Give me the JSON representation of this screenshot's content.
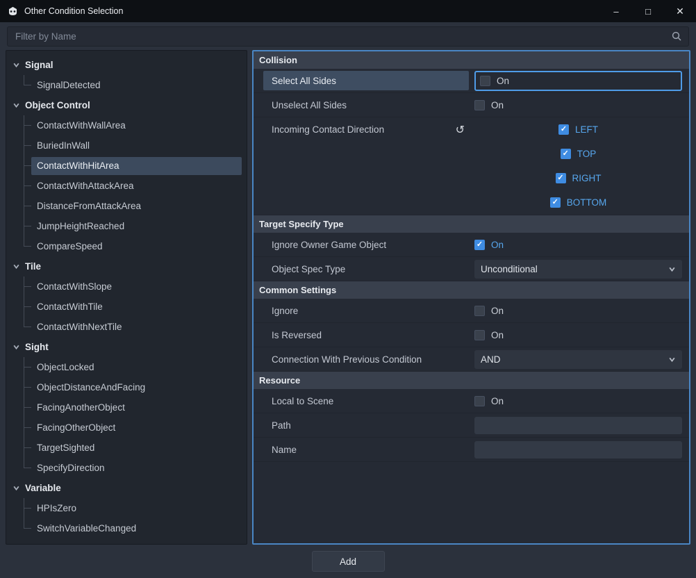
{
  "window": {
    "title": "Other Condition Selection",
    "controls": {
      "minimize": "–",
      "maximize": "□",
      "close": "✕"
    }
  },
  "filter": {
    "placeholder": "Filter by Name"
  },
  "icons": {
    "revert": "↺",
    "check": "✓"
  },
  "colors": {
    "accent_blue": "#57a7ee",
    "checkbox_checked": "#3f8ce2",
    "focus_border": "#4f9ce8",
    "panel_focus_border": "#4a86c4",
    "selection": "#3c4a5d",
    "section_header_bg": "#39404d",
    "titlebar_bg": "#0d1014"
  },
  "tree": {
    "groups": [
      {
        "label": "Signal",
        "items": [
          "SignalDetected"
        ]
      },
      {
        "label": "Object Control",
        "items": [
          "ContactWithWallArea",
          "BuriedInWall",
          "ContactWithHitArea",
          "ContactWithAttackArea",
          "DistanceFromAttackArea",
          "JumpHeightReached",
          "CompareSpeed"
        ],
        "selected_item": "ContactWithHitArea"
      },
      {
        "label": "Tile",
        "items": [
          "ContactWithSlope",
          "ContactWithTile",
          "ContactWithNextTile"
        ]
      },
      {
        "label": "Sight",
        "items": [
          "ObjectLocked",
          "ObjectDistanceAndFacing",
          "FacingAnotherObject",
          "FacingOtherObject",
          "TargetSighted",
          "SpecifyDirection"
        ]
      },
      {
        "label": "Variable",
        "items": [
          "HPIsZero",
          "SwitchVariableChanged"
        ]
      }
    ]
  },
  "inspector": {
    "sections": [
      {
        "title": "Collision",
        "rows": [
          {
            "label": "Select All Sides",
            "type": "checkbox",
            "checked": false,
            "value": "On",
            "selected": true,
            "focused": true
          },
          {
            "label": "Unselect All Sides",
            "type": "checkbox",
            "checked": false,
            "value": "On"
          },
          {
            "label": "Incoming Contact Direction",
            "type": "flags",
            "revert": true,
            "flags": [
              {
                "label": "LEFT",
                "checked": true
              },
              {
                "label": "TOP",
                "checked": true
              },
              {
                "label": "RIGHT",
                "checked": true
              },
              {
                "label": "BOTTOM",
                "checked": true
              }
            ]
          }
        ]
      },
      {
        "title": "Target Specify Type",
        "rows": [
          {
            "label": "Ignore Owner Game Object",
            "type": "checkbox",
            "checked": true,
            "value": "On"
          },
          {
            "label": "Object Spec Type",
            "type": "dropdown",
            "value": "Unconditional"
          }
        ]
      },
      {
        "title": "Common Settings",
        "rows": [
          {
            "label": "Ignore",
            "type": "checkbox",
            "checked": false,
            "value": "On"
          },
          {
            "label": "Is Reversed",
            "type": "checkbox",
            "checked": false,
            "value": "On"
          },
          {
            "label": "Connection With Previous Condition",
            "type": "dropdown",
            "value": "AND"
          }
        ]
      },
      {
        "title": "Resource",
        "rows": [
          {
            "label": "Local to Scene",
            "type": "checkbox",
            "checked": false,
            "value": "On"
          },
          {
            "label": "Path",
            "type": "text",
            "value": ""
          },
          {
            "label": "Name",
            "type": "text",
            "value": ""
          }
        ]
      }
    ]
  },
  "footer": {
    "add_label": "Add"
  }
}
